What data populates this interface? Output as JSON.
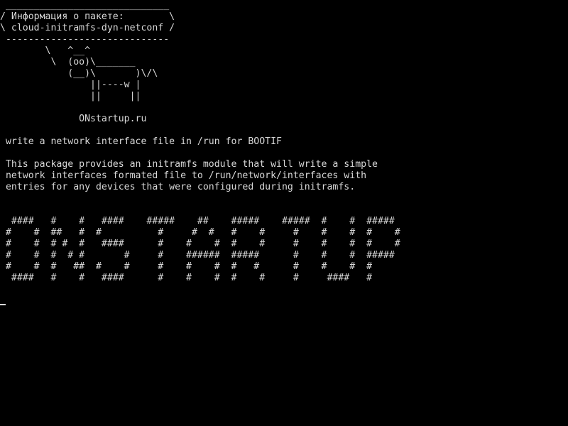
{
  "terminal": {
    "foreground": "#d8d8d8",
    "background": "#000000",
    "lines": [
      " _____________________________",
      "/ Информация о пакете:        \\",
      "\\ cloud-initramfs-dyn-netconf /",
      " -----------------------------",
      "        \\   ^__^",
      "         \\  (oo)\\_______",
      "            (__)\\       )\\/\\",
      "                ||----w |",
      "                ||     ||",
      "",
      "              ONstartup.ru",
      "",
      " write a network interface file in /run for BOOTIF",
      "",
      " This package provides an initramfs module that will write a simple",
      " network interfaces formated file to /run/network/interfaces with",
      " entries for any devices that were configured during initramfs.",
      "",
      "",
      "  ####   #    #   ####    #####    ##    #####    #####  #    #  #####",
      " #    #  ##   #  #          #     #  #   #    #     #    #    #  #    #",
      " #    #  # #  #   ####      #    #    #  #    #     #    #    #  #    #",
      " #    #  #  # #       #     #    ######  #####      #    #    #  #####",
      " #    #  #   ##  #    #     #    #    #  #   #      #    #    #  #",
      "  ####   #    #   ####      #    #    #  #    #     #     ####   #"
    ]
  }
}
